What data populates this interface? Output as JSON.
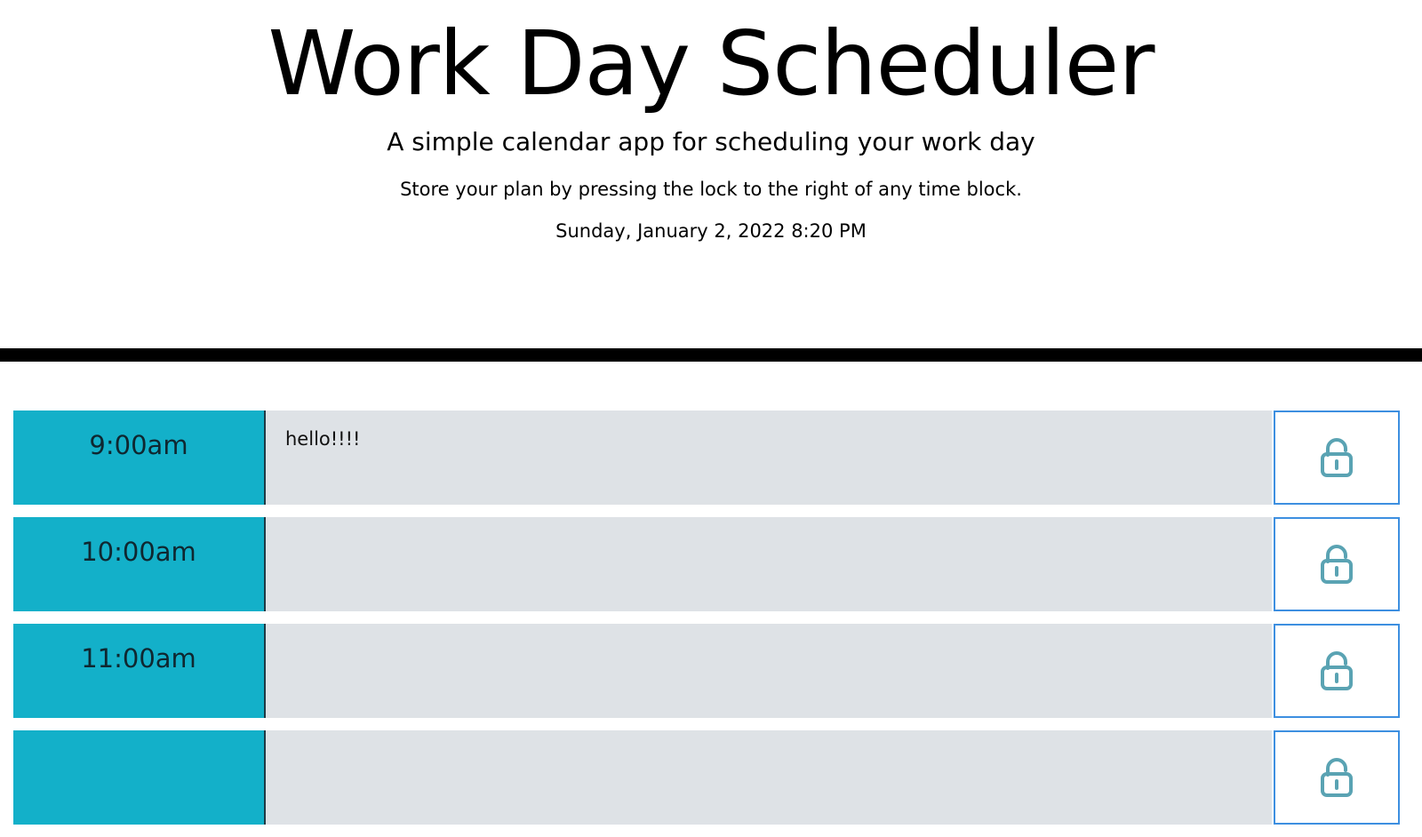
{
  "header": {
    "title": "Work Day Scheduler",
    "subtitle": "A simple calendar app for scheduling your work day",
    "instructions": "Store your plan by pressing the lock to the right of any time block.",
    "current_date": "Sunday, January 2, 2022 8:20 PM"
  },
  "colors": {
    "hour_background": "#13b0c9",
    "description_background": "#dee2e6",
    "save_button_border": "#3d8fe0",
    "lock_icon": "#5aa3b3",
    "divider": "#000000"
  },
  "time_blocks": [
    {
      "hour": "9:00am",
      "description": "hello!!!!",
      "icon": "lock-open-icon"
    },
    {
      "hour": "10:00am",
      "description": "",
      "icon": "lock-open-icon"
    },
    {
      "hour": "11:00am",
      "description": "",
      "icon": "lock-open-icon"
    },
    {
      "hour": "",
      "description": "",
      "icon": "lock-open-icon"
    }
  ]
}
